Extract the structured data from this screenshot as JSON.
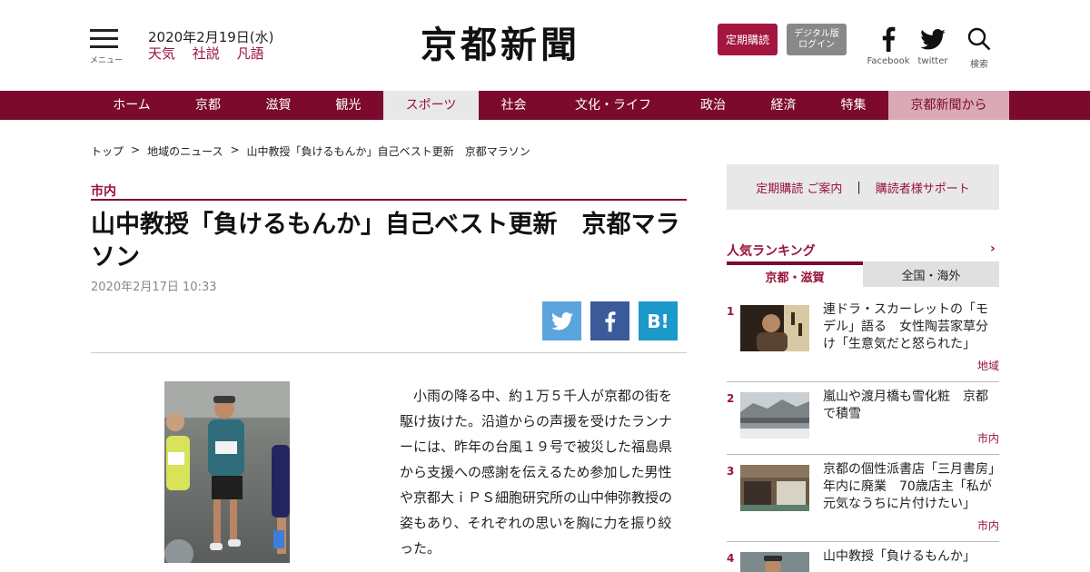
{
  "header": {
    "menu_label": "メニュー",
    "date": "2020年2月19日(水)",
    "quick_links": [
      "天気",
      "社説",
      "凡語"
    ],
    "logo": "京都新聞",
    "subscribe_button": "定期購読",
    "digital_login_line1": "デジタル版",
    "digital_login_line2": "ログイン",
    "social": [
      {
        "label": "Facebook",
        "icon": "facebook-icon"
      },
      {
        "label": "twitter",
        "icon": "twitter-icon"
      },
      {
        "label": "検索",
        "icon": "search-icon"
      }
    ]
  },
  "nav": {
    "items": [
      {
        "label": "ホーム"
      },
      {
        "label": "京都"
      },
      {
        "label": "滋賀"
      },
      {
        "label": "観光"
      },
      {
        "label": "スポーツ"
      },
      {
        "label": "社会"
      },
      {
        "label": "文化・ライフ"
      },
      {
        "label": "政治"
      },
      {
        "label": "経済"
      },
      {
        "label": "特集"
      },
      {
        "label": "京都新聞から"
      }
    ],
    "active": "スポーツ"
  },
  "breadcrumb": {
    "items": [
      "トップ",
      "地域のニュース",
      "山中教授「負けるもんか」自己ベスト更新　京都マラソン"
    ],
    "separator": ">"
  },
  "article": {
    "category": "市内",
    "title": "山中教授「負けるもんか」自己ベスト更新　京都マラソン",
    "date": "2020年2月17日 10:33",
    "share": {
      "twitter": "twitter-icon",
      "facebook": "facebook-icon",
      "hatena": "B!"
    },
    "body": "小雨の降る中、約１万５千人が京都の街を駆け抜けた。沿道からの声援を受けたランナーには、昨年の台風１９号で被災した福島県から支援への感謝を伝えるため参加した男性や京都大ｉＰＳ細胞研究所の山中伸弥教授の姿もあり、それぞれの思いを胸に力を振り絞った。"
  },
  "sidebar": {
    "support_subscribe": "定期購読 ご案内",
    "support_divider": "|",
    "support_reader": "購読者様サポート",
    "ranking_title": "人気ランキング",
    "ranking_more": "›",
    "tabs": [
      "京都・滋賀",
      "全国・海外"
    ],
    "ranking": [
      {
        "rank": "1",
        "title": "連ドラ・スカーレットの「モデル」語る　女性陶芸家草分け「生意気だと怒られた」",
        "category": "地域"
      },
      {
        "rank": "2",
        "title": "嵐山や渡月橋も雪化粧　京都で積雪",
        "category": "市内"
      },
      {
        "rank": "3",
        "title": "京都の個性派書店「三月書房」年内に廃業　70歳店主「私が元気なうちに片付けたい」",
        "category": "市内"
      },
      {
        "rank": "4",
        "title": "山中教授「負けるもんか」",
        "category": ""
      }
    ]
  },
  "colors": {
    "brand": "#7c0a2d",
    "accent": "#98143a",
    "subscribe": "#a3163f",
    "twitter": "#5ba5dc",
    "facebook": "#3b5a9a",
    "hatena": "#1c98c9"
  }
}
